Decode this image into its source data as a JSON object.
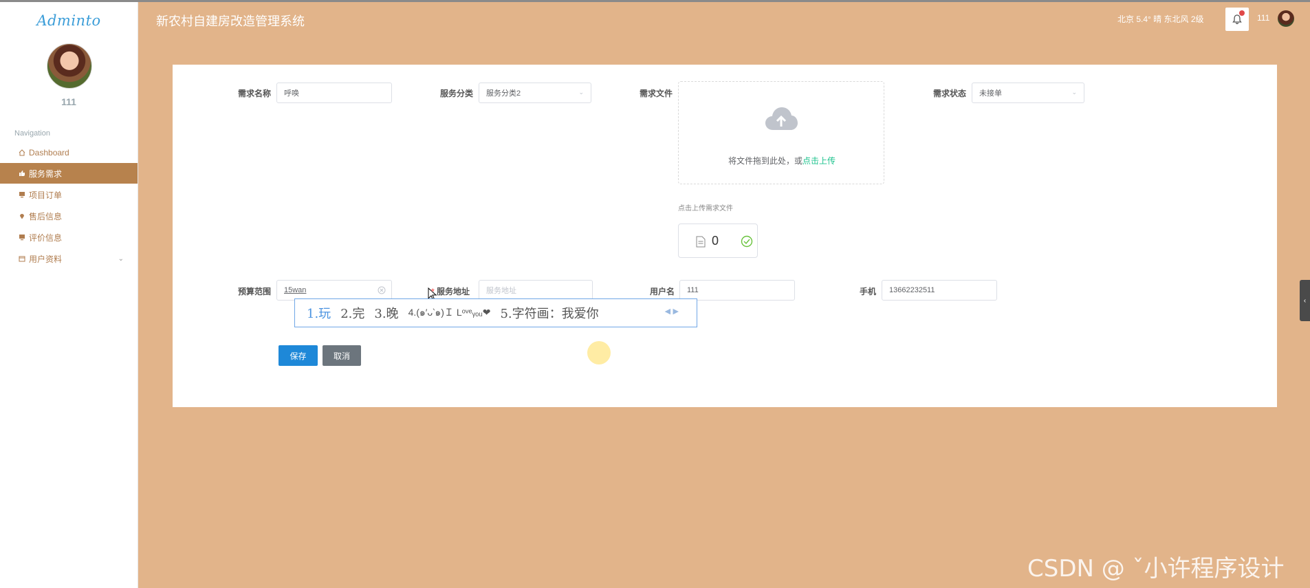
{
  "app": {
    "logo": "Adminto",
    "title": "新农村自建房改造管理系统",
    "weather": "北京  5.4°  晴  东北风  2级",
    "username": "111"
  },
  "sidebar": {
    "username": "111",
    "nav_label": "Navigation",
    "items": [
      {
        "label": "Dashboard",
        "icon": "home-icon"
      },
      {
        "label": "服务需求",
        "icon": "thumbs-up-icon",
        "active": true
      },
      {
        "label": "项目订单",
        "icon": "monitor-icon"
      },
      {
        "label": "售后信息",
        "icon": "location-icon"
      },
      {
        "label": "评价信息",
        "icon": "monitor-icon"
      },
      {
        "label": "用户资料",
        "icon": "calendar-icon"
      }
    ]
  },
  "form": {
    "demand_name": {
      "label": "需求名称",
      "value": "呼唤"
    },
    "service_category": {
      "label": "服务分类",
      "value": "服务分类2"
    },
    "demand_file": {
      "label": "需求文件",
      "upload_text": "将文件拖到此处，或",
      "upload_link": "点击上传",
      "tip": "点击上传需求文件",
      "count": "0"
    },
    "demand_status": {
      "label": "需求状态",
      "value": "未接单"
    },
    "budget": {
      "label": "预算范围",
      "value": "15wan"
    },
    "service_address": {
      "label": "服务地址",
      "required_mark": "*",
      "placeholder": "服务地址"
    },
    "user_name": {
      "label": "用户名",
      "value": "111"
    },
    "phone": {
      "label": "手机",
      "value": "13662232511"
    },
    "save_label": "保存",
    "cancel_label": "取消"
  },
  "ime": {
    "candidates": [
      "1.玩",
      "2.完",
      "3.晚",
      "4.(๑′ᴗ‵๑)Ｉ Lᵒᵛᵉᵧₒᵤ❤",
      "5.字符画：我爱你"
    ]
  },
  "watermark": "CSDN @ ˇ小许程序设计"
}
